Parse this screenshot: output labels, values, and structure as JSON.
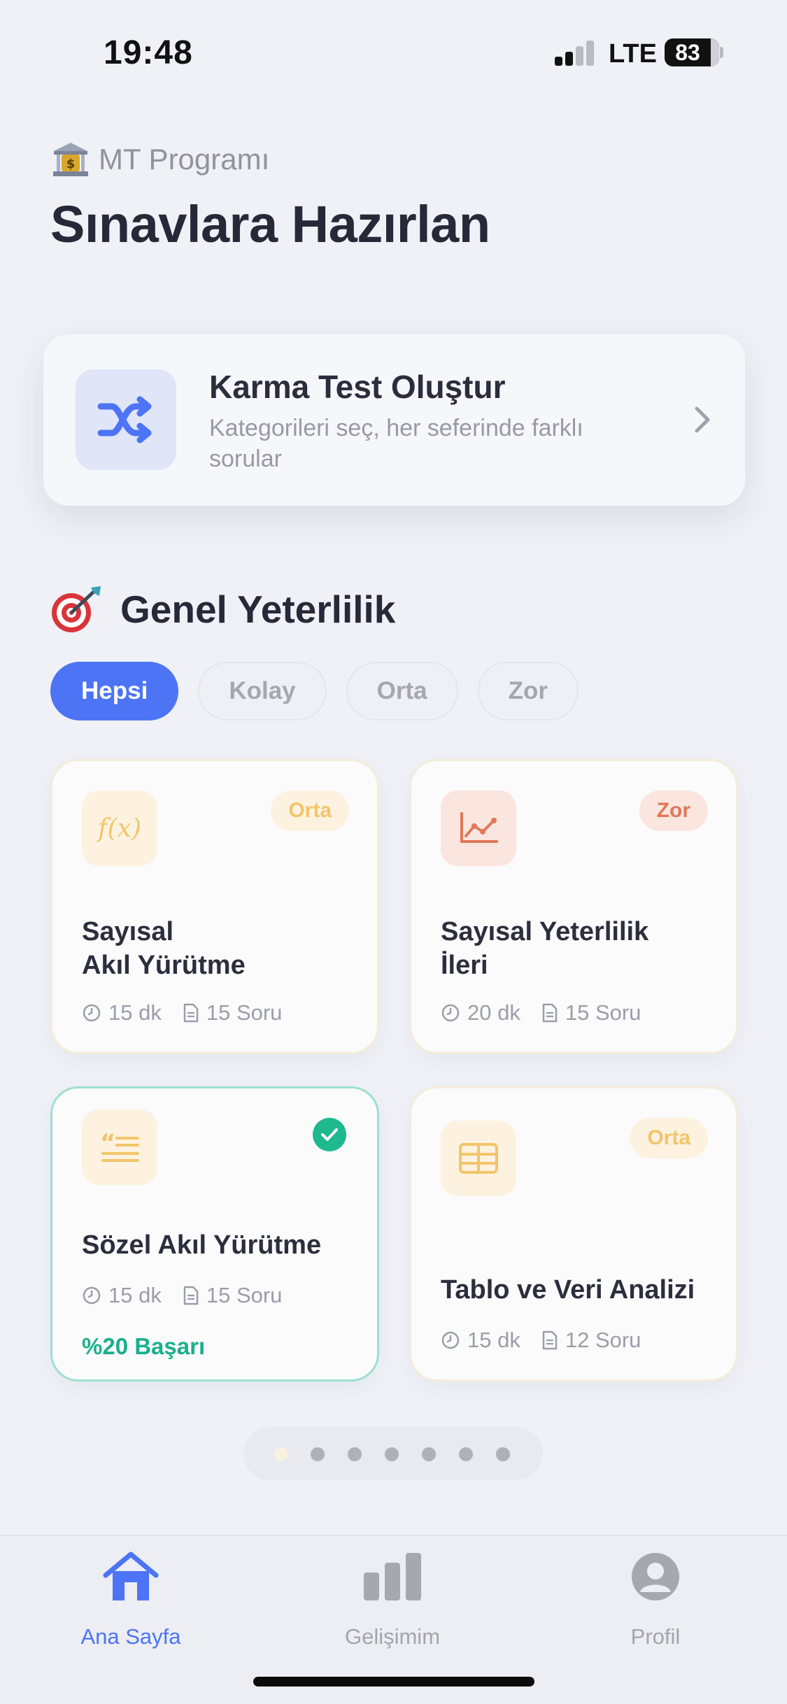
{
  "status": {
    "time": "19:48",
    "network": "LTE",
    "battery": "83"
  },
  "header": {
    "program": "MT Programı",
    "title": "Sınavlara Hazırlan"
  },
  "mixed_test": {
    "title": "Karma Test Oluştur",
    "subtitle": "Kategorileri seç, her seferinde farklı sorular"
  },
  "section": {
    "title": "Genel Yeterlilik"
  },
  "filters": [
    "Hepsi",
    "Kolay",
    "Orta",
    "Zor"
  ],
  "tests": [
    {
      "name_line1": "Sayısal",
      "name_line2": "Akıl Yürütme",
      "badge": "Orta",
      "duration": "15 dk",
      "questions": "15 Soru"
    },
    {
      "name_line1": "Sayısal Yeterlilik",
      "name_line2": "İleri",
      "badge": "Zor",
      "duration": "20 dk",
      "questions": "15 Soru"
    },
    {
      "name": "Sözel Akıl Yürütme",
      "duration": "15 dk",
      "questions": "15 Soru",
      "success": "%20 Başarı"
    },
    {
      "name": "Tablo ve Veri Analizi",
      "badge": "Orta",
      "duration": "15 dk",
      "questions": "12 Soru"
    }
  ],
  "tabbar": [
    {
      "label": "Ana Sayfa",
      "icon": "home-icon"
    },
    {
      "label": "Gelişimim",
      "icon": "bar-chart-icon"
    },
    {
      "label": "Profil",
      "icon": "profile-icon"
    }
  ],
  "colors": {
    "accent": "#4c74f4",
    "success": "#1fb88f",
    "medium": "#f2c56b",
    "hard": "#e1775a"
  }
}
